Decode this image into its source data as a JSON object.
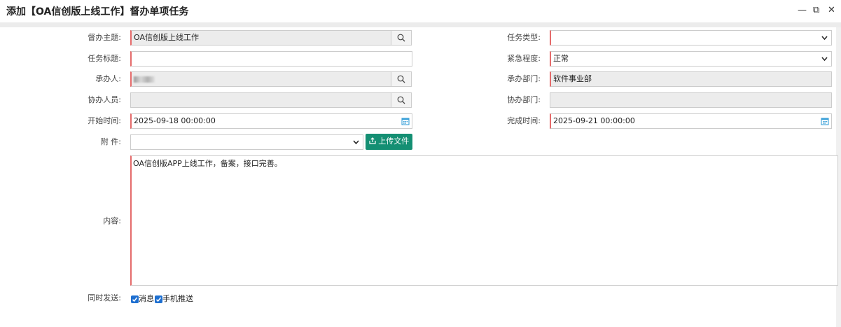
{
  "window": {
    "title": "添加【OA信创版上线工作】督办单项任务",
    "min_glyph": "—",
    "restore_glyph": "⧉",
    "close_glyph": "✕"
  },
  "form": {
    "subject": {
      "label": "督办主题:",
      "value": "OA信创版上线工作"
    },
    "task_type": {
      "label": "任务类型:",
      "value": ""
    },
    "task_title": {
      "label": "任务标题:",
      "value": ""
    },
    "urgency": {
      "label": "紧急程度:",
      "value": "正常"
    },
    "handler": {
      "label": "承办人:",
      "value": ""
    },
    "handler_dept": {
      "label": "承办部门:",
      "value": "软件事业部"
    },
    "assistant": {
      "label": "协办人员:",
      "value": ""
    },
    "assistant_dept": {
      "label": "协办部门:",
      "value": ""
    },
    "start_time": {
      "label": "开始时间:",
      "value": "2025-09-18 00:00:00"
    },
    "finish_time": {
      "label": "完成时间:",
      "value": "2025-09-21 00:00:00"
    },
    "attachment": {
      "label": "附  件:",
      "value": "",
      "upload_label": "上传文件"
    },
    "content": {
      "label": "内容:",
      "value": "OA信创版APP上线工作，备案，接口完善。"
    },
    "notify": {
      "label": "同时发送:",
      "options": [
        {
          "label": "消息",
          "checked": true
        },
        {
          "label": "手机推送",
          "checked": true
        }
      ]
    }
  },
  "colors": {
    "required": "#e56b6b",
    "upload": "#148f73",
    "checkbox": "#1e6fd0",
    "calendar": "#3aa0d8"
  }
}
